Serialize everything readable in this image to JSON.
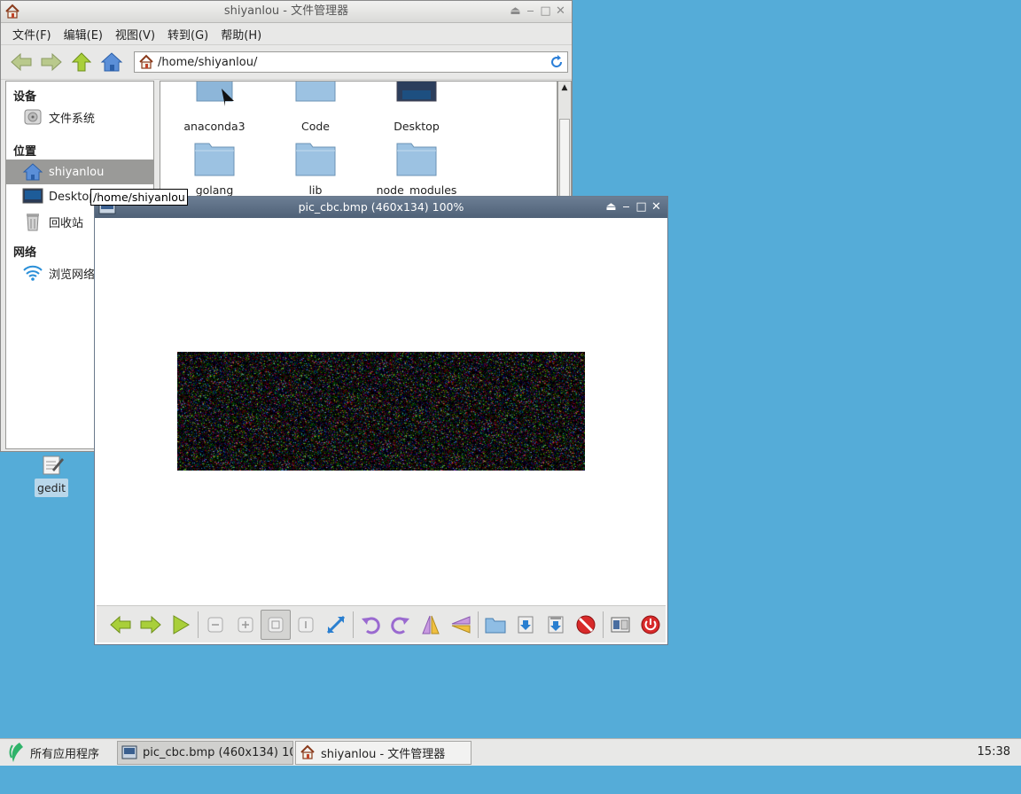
{
  "file_manager": {
    "title": "shiyanlou - 文件管理器",
    "menus": [
      "文件(F)",
      "编辑(E)",
      "视图(V)",
      "转到(G)",
      "帮助(H)"
    ],
    "address": "/home/shiyanlou/",
    "sidebar": {
      "devices_header": "设备",
      "filesystem": "文件系统",
      "places_header": "位置",
      "home": "shiyanlou",
      "desktop": "Desktop",
      "trash": "回收站",
      "network_header": "网络",
      "browse_network": "浏览网络"
    },
    "files": [
      "anaconda3",
      "Code",
      "Desktop",
      "golang",
      "lib",
      "node_modules"
    ],
    "tooltip": "/home/shiyanlou"
  },
  "desktop": {
    "gedit_label": "gedit"
  },
  "viewer": {
    "title": "pic_cbc.bmp (460x134) 100%"
  },
  "taskbar": {
    "start_label": "所有应用程序",
    "task1": "pic_cbc.bmp (460x134) 10…",
    "task2": "shiyanlou - 文件管理器",
    "clock": "15:38"
  },
  "colors": {
    "desktop_bg": "#55acd8",
    "viewer_title": "#5a6b80",
    "selection": "#9a9a98"
  }
}
